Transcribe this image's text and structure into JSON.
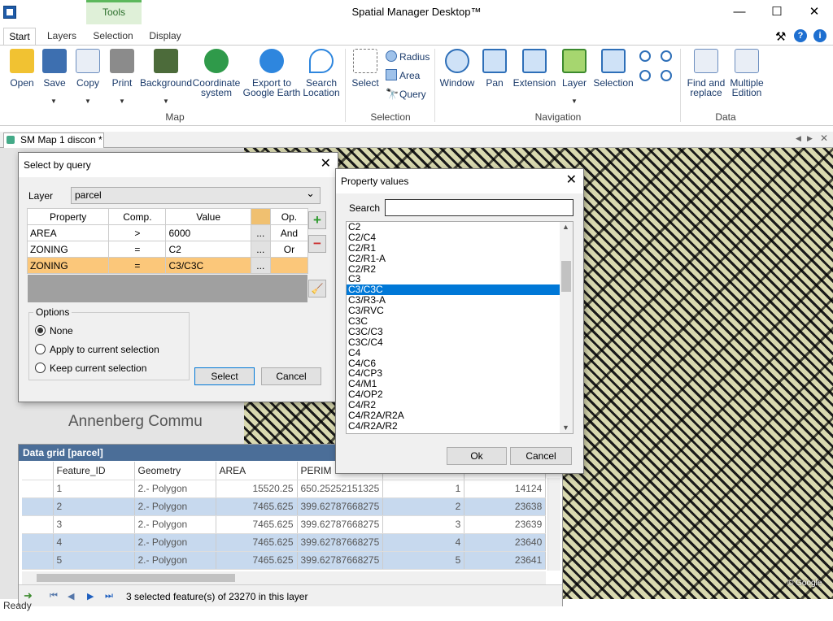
{
  "window": {
    "title": "Spatial Manager Desktop™",
    "min": "—",
    "max": "☐",
    "close": "✕"
  },
  "context_tab": "Tools",
  "tabs": [
    "Start",
    "Layers",
    "Selection",
    "Display"
  ],
  "ribbon": {
    "map": [
      {
        "label": "Open"
      },
      {
        "label": "Save"
      },
      {
        "label": "Copy"
      },
      {
        "label": "Print"
      },
      {
        "label": "Background"
      },
      {
        "label": "Coordinate\nsystem"
      },
      {
        "label": "Export to\nGoogle Earth"
      },
      {
        "label": "Search\nLocation"
      }
    ],
    "selection": {
      "select": "Select",
      "radius": "Radius",
      "area": "Area",
      "query": "Query"
    },
    "navigation": [
      {
        "label": "Window"
      },
      {
        "label": "Pan"
      },
      {
        "label": "Extension"
      },
      {
        "label": "Layer"
      },
      {
        "label": "Selection"
      }
    ],
    "data": [
      {
        "label": "Find and\nreplace"
      },
      {
        "label": "Multiple\nEdition"
      }
    ],
    "group_labels": {
      "map": "Map",
      "selection": "Selection",
      "navigation": "Navigation",
      "data": "Data"
    }
  },
  "doc_tab": {
    "label": "SM Map 1 discon *"
  },
  "map": {
    "place_label": "Annenberg Commu",
    "google": "© Google"
  },
  "select_by_query": {
    "title": "Select by query",
    "layer_label": "Layer",
    "layer_value": "parcel",
    "headers": {
      "property": "Property",
      "comp": "Comp.",
      "value": "Value",
      "op": "Op."
    },
    "rows": [
      {
        "property": "AREA",
        "comp": ">",
        "value": "6000",
        "op": "And"
      },
      {
        "property": "ZONING",
        "comp": "=",
        "value": "C2",
        "op": "Or"
      },
      {
        "property": "ZONING",
        "comp": "=",
        "value": "C3/C3C",
        "op": ""
      }
    ],
    "options_label": "Options",
    "options": [
      "None",
      "Apply to current selection",
      "Keep current selection"
    ],
    "select_btn": "Select",
    "cancel_btn": "Cancel"
  },
  "property_values": {
    "title": "Property values",
    "search_label": "Search",
    "search_value": "",
    "items": [
      "C2",
      "C2/C4",
      "C2/R1",
      "C2/R1-A",
      "C2/R2",
      "C3",
      "C3/C3C",
      "C3/R3-A",
      "C3/RVC",
      "C3C",
      "C3C/C3",
      "C3C/C4",
      "C4",
      "C4/C6",
      "C4/CP3",
      "C4/M1",
      "C4/OP2",
      "C4/R2",
      "C4/R2A/R2A",
      "C4/R2A/R2"
    ],
    "selected": "C3/C3C",
    "ok": "Ok",
    "cancel": "Cancel"
  },
  "data_grid": {
    "title": "Data grid [parcel]",
    "columns": [
      "Feature_ID",
      "Geometry",
      "AREA",
      "PERIM",
      "",
      ""
    ],
    "rows": [
      [
        "1",
        "2.- Polygon",
        "15520.25",
        "650.25252151325",
        "1",
        "14124"
      ],
      [
        "2",
        "2.- Polygon",
        "7465.625",
        "399.62787668275",
        "2",
        "23638"
      ],
      [
        "3",
        "2.- Polygon",
        "7465.625",
        "399.62787668275",
        "3",
        "23639"
      ],
      [
        "4",
        "2.- Polygon",
        "7465.625",
        "399.62787668275",
        "4",
        "23640"
      ],
      [
        "5",
        "2.- Polygon",
        "7465.625",
        "399.62787668275",
        "5",
        "23641"
      ]
    ],
    "status": "3 selected feature(s) of 23270 in this layer",
    "ready": "Ready"
  }
}
